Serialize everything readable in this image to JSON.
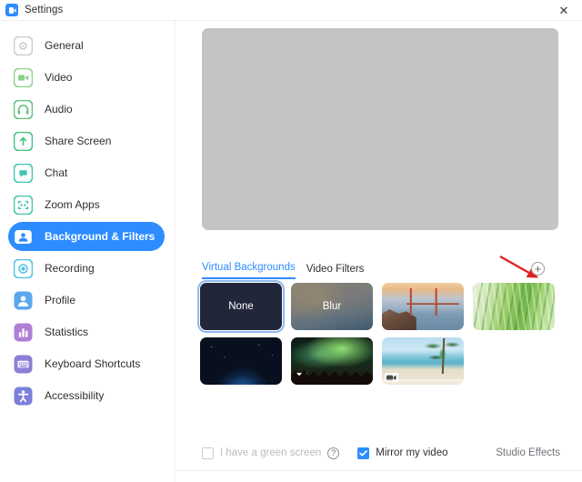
{
  "window": {
    "title": "Settings",
    "logo_icon": "zoom-logo-icon",
    "close_label": "✕"
  },
  "sidebar": {
    "items": [
      {
        "label": "General",
        "icon": "gear-icon",
        "color": "#c9cbcf",
        "active": false
      },
      {
        "label": "Video",
        "icon": "video-camera-icon",
        "color": "#8fd18a",
        "active": false
      },
      {
        "label": "Audio",
        "icon": "headphones-icon",
        "color": "#5ec07f",
        "active": false
      },
      {
        "label": "Share Screen",
        "icon": "share-screen-icon",
        "color": "#45c07e",
        "active": false
      },
      {
        "label": "Chat",
        "icon": "chat-bubble-icon",
        "color": "#3fc3b5",
        "active": false
      },
      {
        "label": "Zoom Apps",
        "icon": "zoom-apps-icon",
        "color": "#48c3a8",
        "active": false
      },
      {
        "label": "Background & Filters",
        "icon": "background-icon",
        "color": "#2d8cff",
        "active": true
      },
      {
        "label": "Recording",
        "icon": "record-icon",
        "color": "#4fc0e8",
        "active": false
      },
      {
        "label": "Profile",
        "icon": "profile-icon",
        "color": "#5aa7ef",
        "active": false
      },
      {
        "label": "Statistics",
        "icon": "bar-chart-icon",
        "color": "#b07fd4",
        "active": false
      },
      {
        "label": "Keyboard Shortcuts",
        "icon": "keyboard-icon",
        "color": "#8d7fd6",
        "active": false
      },
      {
        "label": "Accessibility",
        "icon": "accessibility-icon",
        "color": "#7b7fdb",
        "active": false
      }
    ]
  },
  "main": {
    "preview": {
      "name": "video-preview",
      "state": "blank"
    },
    "tabs": [
      {
        "label": "Virtual Backgrounds",
        "active": true
      },
      {
        "label": "Video Filters",
        "active": false
      }
    ],
    "add_button": {
      "label": "+",
      "name": "add-background-button"
    },
    "annotation": {
      "type": "red-arrow",
      "points_to": "add-background-button",
      "color": "#e02020"
    },
    "backgrounds": [
      {
        "label": "None",
        "art": "t-none",
        "selected": true,
        "has_video": false
      },
      {
        "label": "Blur",
        "art": "t-blur",
        "selected": false,
        "has_video": false
      },
      {
        "label": "",
        "art": "t-bridge",
        "selected": false,
        "has_video": false
      },
      {
        "label": "",
        "art": "t-grass",
        "selected": false,
        "has_video": false
      },
      {
        "label": "",
        "art": "t-earth",
        "selected": false,
        "has_video": false
      },
      {
        "label": "",
        "art": "t-aurora",
        "selected": false,
        "has_video": true
      },
      {
        "label": "",
        "art": "t-beach",
        "selected": false,
        "has_video": true
      }
    ]
  },
  "footer": {
    "green_screen": {
      "label": "I have a green screen",
      "checked": false,
      "disabled": true
    },
    "help_icon": "?",
    "mirror_video": {
      "label": "Mirror my video",
      "checked": true
    },
    "studio_effects": "Studio Effects"
  },
  "colors": {
    "accent": "#2d8cff",
    "annotation_red": "#e02020",
    "preview_grey": "#c4c4c4",
    "text": "#2f2f2f",
    "muted": "#b9bcc1"
  }
}
